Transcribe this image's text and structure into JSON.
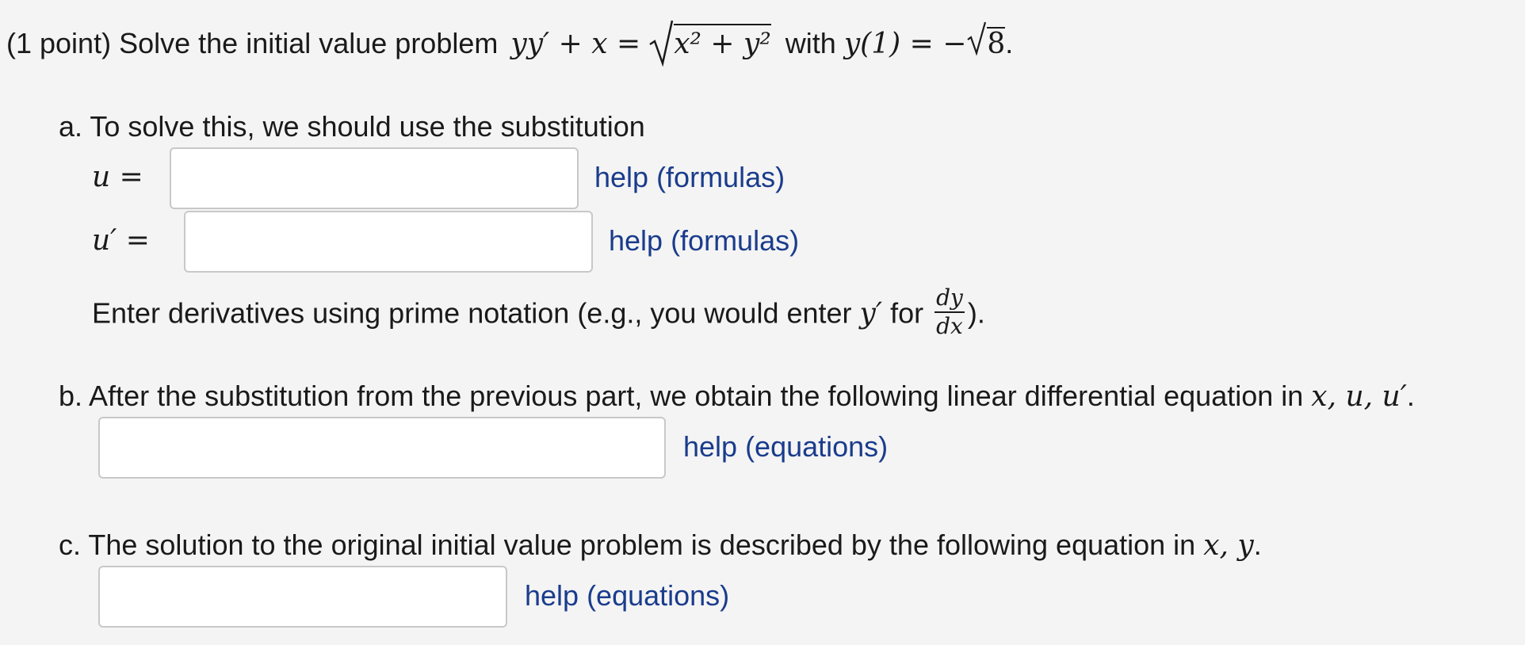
{
  "problem": {
    "point_label": "(1 point)",
    "statement_prefix": "Solve the initial value problem",
    "equation_lhs": "yy′ + x =",
    "radicand": "x² + y²",
    "with_text": "with",
    "condition_lhs": "y(1) = −",
    "condition_radicand": "8",
    "end": "."
  },
  "part_a": {
    "label": "a.",
    "text": "To solve this, we should use the substitution",
    "u_label": "u =",
    "u_prime_label": "u′ =",
    "u_value": "",
    "u_prime_value": "",
    "help_u": "help (formulas)",
    "help_u_prime": "help (formulas)",
    "note_prefix": "Enter derivatives using prime notation (e.g., you would enter",
    "note_math": "y′",
    "note_for": "for",
    "frac_num": "dy",
    "frac_den": "dx",
    "note_suffix": ")."
  },
  "part_b": {
    "label": "b.",
    "text": "After the substitution from the previous part, we obtain the following linear differential equation in",
    "vars": "x, u, u′",
    "end": ".",
    "value": "",
    "help": "help (equations)"
  },
  "part_c": {
    "label": "c.",
    "text": "The solution to the original initial value problem is described by the following equation in",
    "vars": "x, y",
    "end": ".",
    "value": "",
    "help": "help (equations)"
  }
}
